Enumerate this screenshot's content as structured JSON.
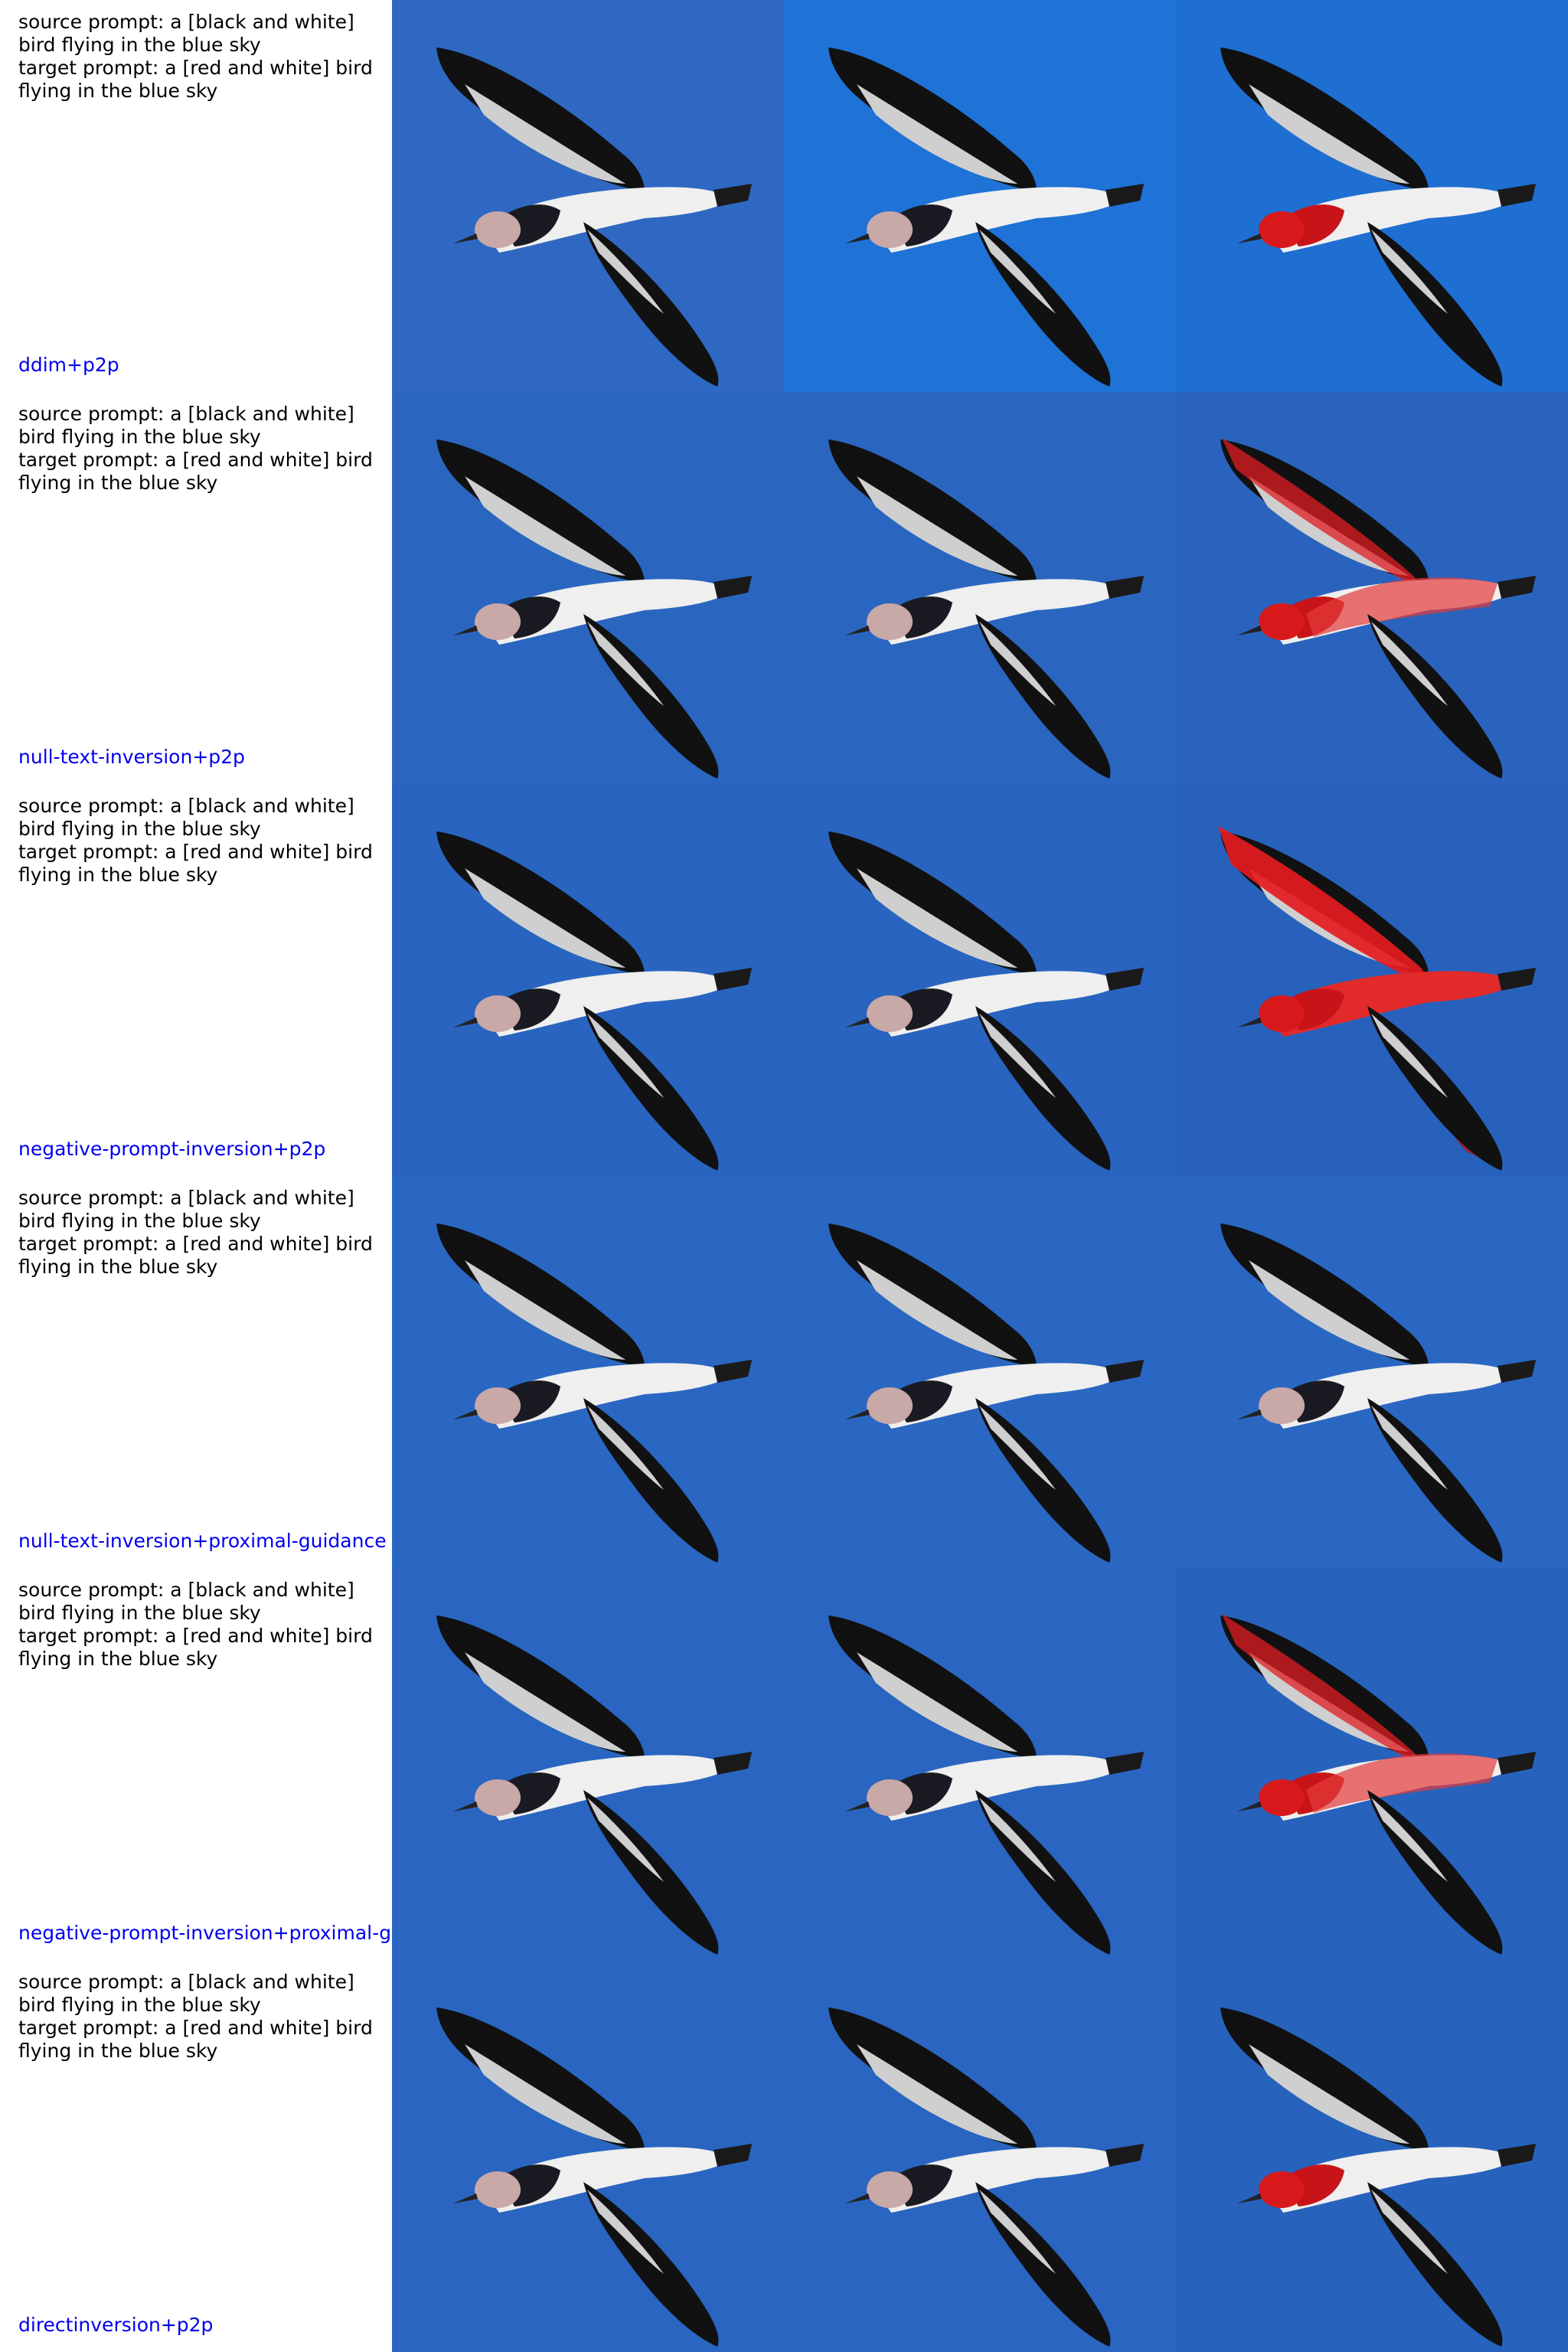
{
  "source_prompt": "source prompt: a [black and white]\nbird flying in the blue sky",
  "target_prompt": "target prompt: a [red and white] bird\nflying in the blue sky",
  "label_color": "#0000ee",
  "rows": [
    {
      "method": "ddim+p2p",
      "images": [
        {
          "sky": "#2f68c2",
          "tint": "none"
        },
        {
          "sky": "#1f72d6",
          "tint": "none"
        },
        {
          "sky": "#1f6ed2",
          "tint": "red_head"
        }
      ]
    },
    {
      "method": "null-text-inversion+p2p",
      "images": [
        {
          "sky": "#2a66c0",
          "tint": "none"
        },
        {
          "sky": "#2a66c0",
          "tint": "none"
        },
        {
          "sky": "#2a63bd",
          "tint": "red_partial"
        }
      ]
    },
    {
      "method": "negative-prompt-inversion+p2p",
      "images": [
        {
          "sky": "#2864c0",
          "tint": "none"
        },
        {
          "sky": "#2864c0",
          "tint": "none"
        },
        {
          "sky": "#2761bc",
          "tint": "red_full"
        }
      ]
    },
    {
      "method": "null-text-inversion+proximal-guidance",
      "images": [
        {
          "sky": "#2a67c3",
          "tint": "none"
        },
        {
          "sky": "#2a67c3",
          "tint": "none"
        },
        {
          "sky": "#2a67c3",
          "tint": "none"
        }
      ]
    },
    {
      "method": "negative-prompt-inversion+proximal-g",
      "images": [
        {
          "sky": "#2965c1",
          "tint": "none"
        },
        {
          "sky": "#2965c1",
          "tint": "none"
        },
        {
          "sky": "#2762bd",
          "tint": "red_partial"
        }
      ]
    },
    {
      "method": "directinversion+p2p",
      "images": [
        {
          "sky": "#2965c1",
          "tint": "none"
        },
        {
          "sky": "#2965c1",
          "tint": "none"
        },
        {
          "sky": "#2762bd",
          "tint": "red_head"
        }
      ]
    }
  ]
}
